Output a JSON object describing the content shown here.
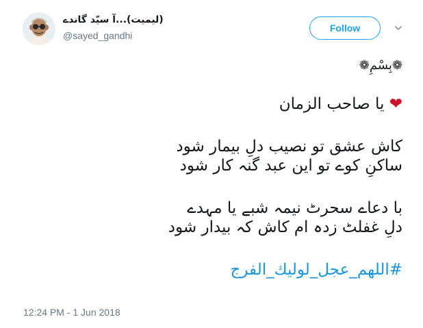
{
  "author": {
    "display_name": "(لیمیت)...آ سیّد گاندے",
    "handle": "@sayed_gandhi"
  },
  "follow_label": "Follow",
  "tweet": {
    "basmala": "❁بِسْمِ❁",
    "heart": "❤",
    "lines": [
      "یا صاحب الزمان",
      "کاش عشق تو نصیب دلِ بیمار شود",
      "ساکنِ کوے تو این عبد گنہ کار شود",
      "با دعاے سحرٹ نیمہ شبے یا مہدے",
      "دلِ غفلٹ زدہ ام کاش کہ بیدار شود"
    ],
    "hashtag": "#اللهم_عجل_لوليك_الفرج"
  },
  "timestamp": "12:24 PM - 1 Jun 2018",
  "colors": {
    "accent": "#1da1f2",
    "hashtag": "#1b95e0",
    "heart": "#d0112b",
    "secondary_text": "#657786"
  },
  "icons": {
    "avatar": "avatar-image",
    "caret": "chevron-down-icon"
  }
}
